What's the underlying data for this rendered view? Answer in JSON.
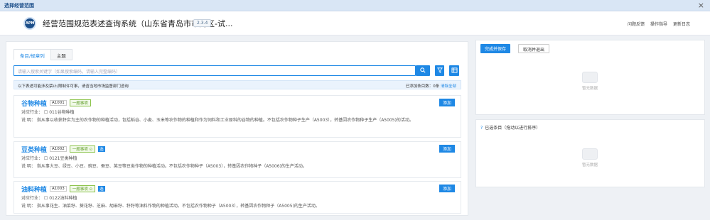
{
  "window": {
    "title": "选择经营范围",
    "close": "×"
  },
  "header": {
    "logo_text": "APM",
    "title": "经营范围规范表述查询系统（山东省青岛市市南区-试...",
    "version": "2.3.4",
    "links": [
      "问题反馈",
      "操作指导",
      "更新日志"
    ]
  },
  "tabs": [
    "条目/规章列",
    "主题"
  ],
  "search": {
    "placeholder": "请输入搜索关键字（如果搜索编码，请输入完整编码）",
    "search_icon": "search-icon",
    "filter_icon": "filter-icon",
    "grid_icon": "grid-icon"
  },
  "notice": {
    "text": "以下表述可能涉及禁止/限制许可事，请咨当地市场监督部门咨询",
    "selected_label": "已添加条目数：",
    "selected_count": "0条",
    "clear_link": "清除全部"
  },
  "items": [
    {
      "name": "谷物种植",
      "code": "A1001",
      "tag": "一般事项",
      "xuan": "",
      "industry": "对应行业：  ☐ 011谷物种植",
      "desc": "说    明：  指从事以收获籽实为主的农作物的种植活动，包括稻谷、小麦、玉米等农作物的种植和作为饲料和工业原料的谷物的种植。不包括农作物种子生产（A5003），转基因农作物种子生产（A5005)的活动。",
      "add": "添加"
    },
    {
      "name": "豆类种植",
      "code": "A1002",
      "tag": "一般事项 ⊙",
      "xuan": "选",
      "industry": "对应行业：  ☐ 0121豆类种植",
      "desc": "说    明：  指从事大豆、绿豆、小豆、豌豆、蚕豆、莴豆等豆类作物的种植活动。不包括农作物种子（A5003），转基因农作物种子（A5006)的生产活动。",
      "add": "添加"
    },
    {
      "name": "油料种植",
      "code": "A1003",
      "tag": "一般事项 ⊙",
      "xuan": "选",
      "industry": "对应行业：  ☐ 0122油料种植",
      "desc": "说    明：  指从事花生、油菜籽、葵花籽、芝麻、胡麻籽、籽籽等油料作物的种植活动。不包括农作物种子（A5003），转基因农作物种子（A5005)的生产活动。",
      "add": "添加"
    }
  ],
  "right": {
    "save_btn": "完成并保存",
    "cancel_btn": "取消并退出",
    "empty1": "暂无数据",
    "selected_title": "已选条目（拖动以进行排序）",
    "empty2": "暂无数据"
  }
}
